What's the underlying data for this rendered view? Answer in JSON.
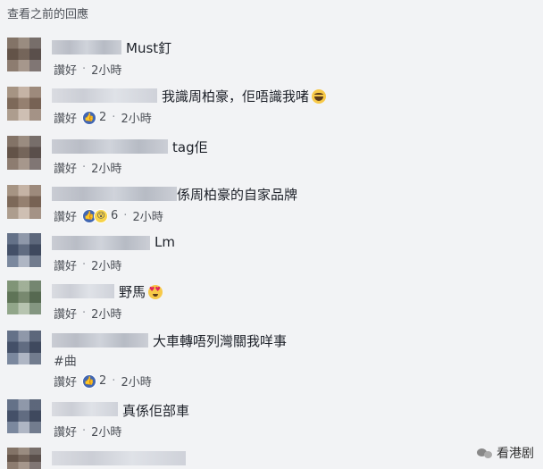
{
  "header": {
    "title": "查看之前的回應"
  },
  "comments": [
    {
      "text": "Must釘",
      "like": "讚好",
      "sep": "·",
      "time": "2小時"
    },
    {
      "text": "我識周柏豪，佢唔識我啫",
      "like": "讚好",
      "sep": "·",
      "reaction_count": "2",
      "time": "2小時"
    },
    {
      "text": "tag佢",
      "like": "讚好",
      "sep": "·",
      "time": "2小時"
    },
    {
      "text": "係周柏豪的自家品牌",
      "like": "讚好",
      "sep": "·",
      "reaction_count": "6",
      "time": "2小時"
    },
    {
      "text": "Lm",
      "like": "讚好",
      "sep": "·",
      "time": "2小時"
    },
    {
      "text": "野馬",
      "like": "讚好",
      "sep": "·",
      "time": "2小時"
    },
    {
      "text": "大車轉唔列灣關我咩事",
      "text2": "#曲",
      "like": "讚好",
      "sep": "·",
      "reaction_count": "2",
      "time": "2小時"
    },
    {
      "text": "真係佢部車",
      "like": "讚好",
      "sep": "·",
      "time": "2小時"
    }
  ],
  "watermark": {
    "label": "看港剧"
  },
  "icons": {
    "like": "thumbs-up-icon",
    "wow": "wow-icon",
    "laugh": "laughing-emoji-icon",
    "love": "heart-eyes-emoji-icon",
    "watermark": "wechat-icon"
  },
  "colors": {
    "like_blue": "#4267b2",
    "meta_gray": "#4b4f56",
    "background": "#f2f3f5"
  }
}
